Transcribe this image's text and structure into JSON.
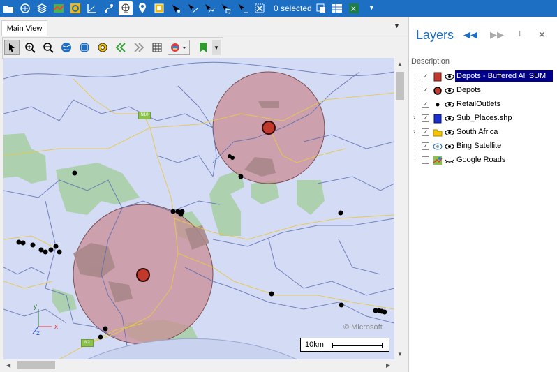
{
  "toolbar_top": {
    "selected_count": "0 selected",
    "icons": [
      "folder-icon",
      "add-layer-icon",
      "layers-icon",
      "map-icon",
      "buffer-icon",
      "measure-icon",
      "nodes-icon",
      "globe-icon",
      "pin-icon",
      "select-box-icon",
      "select-point-icon",
      "select-line-icon",
      "select-polyline-icon",
      "select-area-icon",
      "clear-selection-icon",
      "zoom-to-selection-icon",
      "attribute-table-icon",
      "excel-icon",
      "dropdown-arrow-icon"
    ]
  },
  "view": {
    "tab_label": "Main View",
    "map_toolbar": [
      "pointer-icon",
      "zoom-in-icon",
      "zoom-out-icon",
      "full-extent-icon",
      "zoom-layer-icon",
      "settings-icon",
      "previous-extent-icon",
      "next-extent-icon",
      "grid-icon",
      "basemap-dropdown-icon",
      "bookmark-icon",
      "more-icon"
    ]
  },
  "map": {
    "scale_label": "10km",
    "copyright": "© Microsoft",
    "road_labels": [
      "N10",
      "N2"
    ],
    "axis_labels": {
      "x": "x",
      "y": "y",
      "z": "z"
    }
  },
  "layers_panel": {
    "title": "Layers",
    "column_header": "Description",
    "layers": [
      {
        "name": "Depots - Buffered All SUM",
        "checked": true,
        "selected": true,
        "expandable": false,
        "icon": "polygon-red-icon"
      },
      {
        "name": "Depots",
        "checked": true,
        "selected": false,
        "expandable": false,
        "icon": "point-red-icon"
      },
      {
        "name": "RetailOutlets",
        "checked": true,
        "selected": false,
        "expandable": false,
        "icon": "point-black-icon"
      },
      {
        "name": "Sub_Places.shp",
        "checked": true,
        "selected": false,
        "expandable": true,
        "icon": "polygon-blue-icon"
      },
      {
        "name": "South Africa",
        "checked": true,
        "selected": false,
        "expandable": true,
        "icon": "folder-icon"
      },
      {
        "name": "Bing Satellite",
        "checked": true,
        "selected": false,
        "expandable": false,
        "icon": "satellite-icon"
      },
      {
        "name": "Google Roads",
        "checked": false,
        "selected": false,
        "expandable": false,
        "icon": "roads-icon"
      }
    ]
  },
  "colors": {
    "accent": "#1d6fc4",
    "buffer_fill": "#c98e94",
    "depot": "#c0392b",
    "map_background": "#d4dcf5",
    "green_area": "#a9cfa8"
  }
}
